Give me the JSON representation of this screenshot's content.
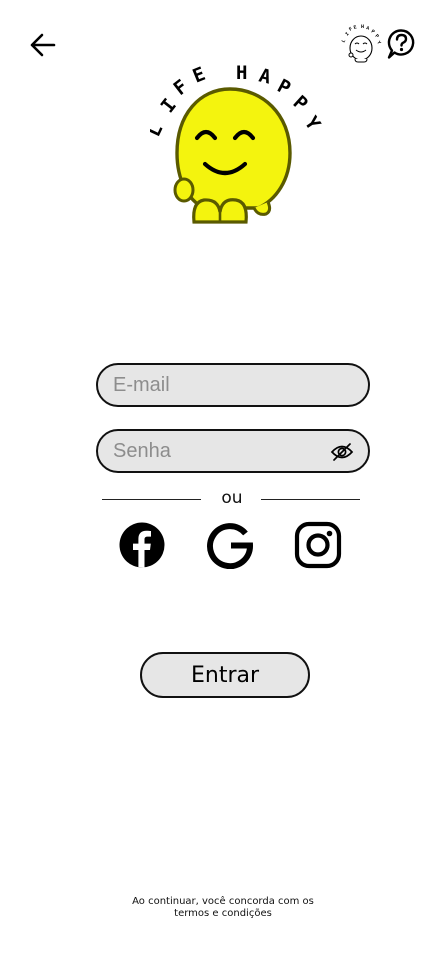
{
  "app": {
    "brand_text": "LIFE HAPPY"
  },
  "header": {
    "back_icon": "arrow-left-icon",
    "help_icon": "help-bubble-icon"
  },
  "form": {
    "email_placeholder": "E-mail",
    "password_placeholder": "Senha",
    "eye_icon": "eye-slash-icon",
    "divider_text": "ou"
  },
  "social": [
    {
      "name": "facebook",
      "icon": "facebook-icon"
    },
    {
      "name": "google",
      "icon": "google-icon"
    },
    {
      "name": "instagram",
      "icon": "instagram-icon"
    }
  ],
  "actions": {
    "login_label": "Entrar"
  },
  "footer": {
    "terms_line1": "Ao continuar, você concorda com os",
    "terms_line2": "termos e condições"
  },
  "colors": {
    "mascot_yellow": "#f4f40e",
    "mascot_outline": "#5a5a00",
    "field_bg": "#e6e6e6",
    "border": "#111111"
  }
}
